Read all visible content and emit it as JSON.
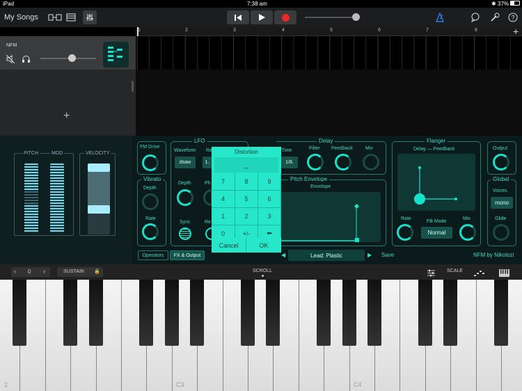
{
  "statusbar": {
    "device": "iPad",
    "time": "7:38 am",
    "battery": "37%"
  },
  "toolbar": {
    "my_songs": "My Songs"
  },
  "ruler": {
    "bars": [
      "1",
      "2",
      "3",
      "4",
      "5",
      "6",
      "7",
      "8"
    ]
  },
  "track": {
    "name": "NFM",
    "volume": 0.8
  },
  "controls": {
    "pitch": "PITCH",
    "mod": "MOD",
    "velocity": "VELOCITY"
  },
  "synth": {
    "fm_drive": "FM Drive",
    "lfo": {
      "title": "LFO",
      "waveform": "Waveform",
      "waveform_value": "dsaw",
      "rate": "Ra",
      "rate_value": "1.",
      "depth": "Depth",
      "phase": "Ph",
      "sync": "Sync",
      "retrig": "Re"
    },
    "vibrato": {
      "title": "Vibrato",
      "depth": "Depth",
      "rate": "Rate"
    },
    "delay": {
      "title": "Delay",
      "time": "Time",
      "time_value": "1/8.",
      "filter": "Filter",
      "feedback": "Feedback",
      "mix": "Mix"
    },
    "pitch_env": {
      "title": "Pitch Envelope",
      "envelope": "Envelope"
    },
    "flanger": {
      "title": "Flanger",
      "delay_feedback": "Delay — Feedback",
      "rate": "Rate",
      "fb_mode": "FB Mode",
      "fb_mode_value": "Normal",
      "mix": "Mix"
    },
    "output": "Output",
    "global": {
      "title": "Global",
      "voices": "Voices",
      "voices_value": "mono",
      "glide": "Glide"
    },
    "tabs": {
      "operators": "Operators",
      "fx_output": "FX & Output"
    },
    "preset": "Lead: Plastic",
    "save": "Save",
    "credit": "NFM by Nikolozi"
  },
  "keypad": {
    "title": "Distortion",
    "display": "_",
    "keys": [
      "7",
      "8",
      "9",
      "4",
      "5",
      "6",
      "1",
      "2",
      "3",
      "0",
      "+/-",
      "⬅"
    ],
    "cancel": "Cancel",
    "ok": "OK"
  },
  "kbbar": {
    "octave": "0",
    "sustain": "SUSTAIN",
    "scroll": "SCROLL",
    "scale": "SCALE"
  },
  "keyboard": {
    "labels": [
      "2",
      "C3",
      "C4"
    ]
  },
  "colors": {
    "accent": "#16e3cc",
    "record": "#e8282b"
  }
}
